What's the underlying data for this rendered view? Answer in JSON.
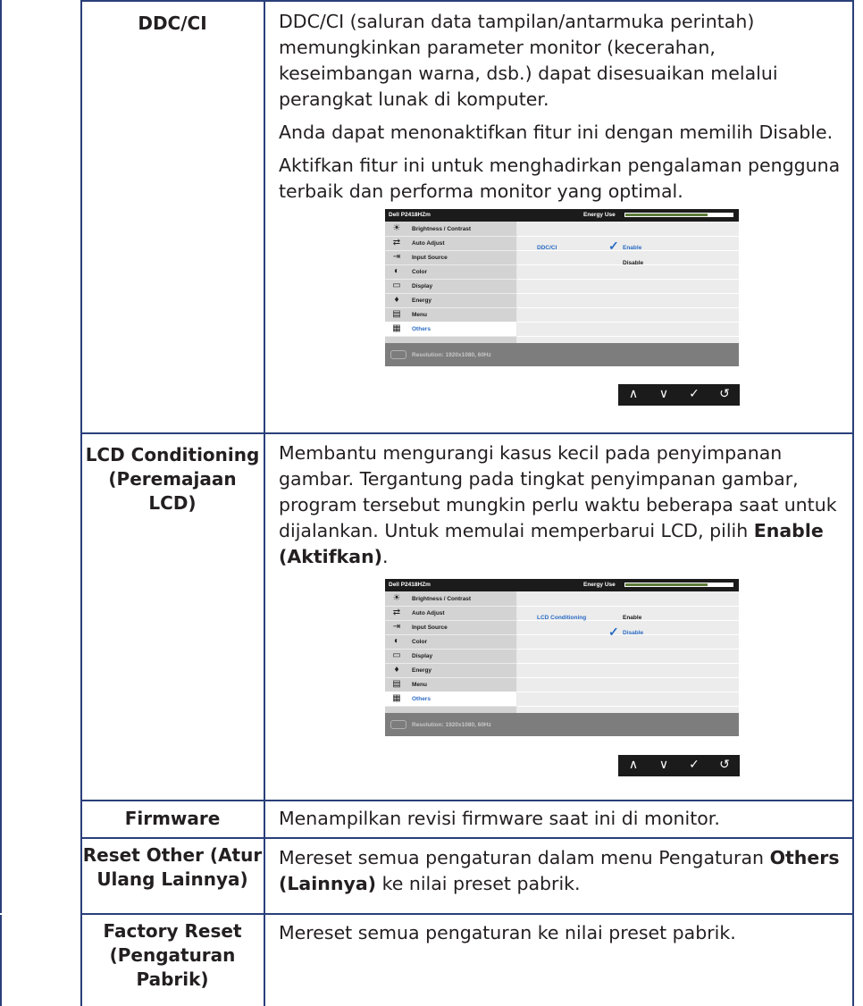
{
  "rows": [
    {
      "label": "DDC/CI",
      "paragraphs": [
        "DDC/CI (saluran data tampilan/antarmuka perintah) memungkinkan parameter monitor (kecerahan, keseimbangan warna, dsb.) dapat disesuaikan melalui perangkat lunak di komputer.",
        "Anda dapat menonaktifkan fitur ini dengan memilih Disable.",
        "Aktifkan fitur ini untuk menghadirkan pengalaman pengguna terbaik dan performa monitor yang optimal."
      ]
    },
    {
      "label": "LCD Conditioning (Peremajaan LCD)",
      "paragraph": "Membantu mengurangi kasus kecil pada penyimpanan gambar. Tergantung pada tingkat penyimpanan gambar, program tersebut mungkin perlu waktu beberapa saat untuk dijalankan. Untuk memulai memperbarui LCD, pilih",
      "paragraph_bold": "Enable (Aktifkan)",
      "paragraph_end": "."
    },
    {
      "label": "Firmware",
      "paragraph": "Menampilkan revisi firmware saat ini di monitor."
    },
    {
      "label": "Reset Other (Atur Ulang Lainnya)",
      "paragraph": "Mereset semua pengaturan dalam menu Pengaturan",
      "paragraph_bold": "Others (Lainnya)",
      "paragraph_end": "ke nilai preset pabrik."
    },
    {
      "label": "Factory Reset (Pengaturan Pabrik)",
      "paragraph": "Mereset semua pengaturan ke nilai preset pabrik."
    }
  ],
  "osd": {
    "model": "Dell P2418HZm",
    "energy_label": "Energy Use",
    "energy_level": 0.77,
    "menu_items": [
      {
        "label": "Brightness / Contrast",
        "icon": "sun-icon"
      },
      {
        "label": "Auto Adjust",
        "icon": "arrows-icon"
      },
      {
        "label": "Input Source",
        "icon": "input-icon"
      },
      {
        "label": "Color",
        "icon": "color-icon"
      },
      {
        "label": "Display",
        "icon": "display-icon"
      },
      {
        "label": "Energy",
        "icon": "energy-icon"
      },
      {
        "label": "Menu",
        "icon": "menu-icon"
      },
      {
        "label": "Others",
        "icon": "others-icon"
      }
    ],
    "resolution": "Resolution: 1920x1080, 60Hz",
    "ddc": {
      "setting": "DDC/CI",
      "opt1": "Enable",
      "opt2": "Disable",
      "selected": "Enable"
    },
    "lcd": {
      "setting": "LCD Conditioning",
      "opt1": "Enable",
      "opt2": "Disable",
      "selected": "Disable"
    },
    "nav": [
      "∧",
      "∨",
      "✓",
      "↺"
    ]
  },
  "colors": {
    "border": "#2a3f7a",
    "accent": "#2b6cc4",
    "energy_bar": "#5d7b3a"
  }
}
